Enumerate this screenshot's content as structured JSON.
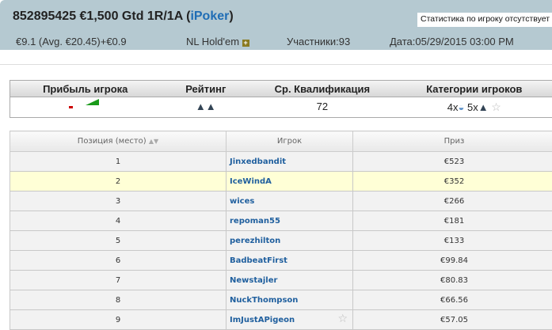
{
  "header": {
    "tournament": "852895425 €1,500 Gtd 1R/1A (",
    "network": "iPoker",
    "close_paren": ")",
    "no_stats": "Статистика по игроку отсутствует",
    "buyin": "€9.1 (Avg. €20.45)+€0.9",
    "game": "NL Hold'em",
    "participants": "Участники:93",
    "date": "Дата:05/29/2015 03:00 PM"
  },
  "stats": {
    "headers": [
      "Прибыль игрока",
      "Рейтинг",
      "Ср. Квалификация",
      "Категории игроков"
    ],
    "avg_qualification": "72",
    "cat_fish": "4x",
    "cat_shark": "5x"
  },
  "results": {
    "headers": [
      "Позиция (место)",
      "Игрок",
      "Приз"
    ],
    "rows": [
      {
        "pos": "1",
        "player": "Jinxedbandit",
        "prize": "€523"
      },
      {
        "pos": "2",
        "player": "IceWindA",
        "prize": "€352"
      },
      {
        "pos": "3",
        "player": "wices",
        "prize": "€266"
      },
      {
        "pos": "4",
        "player": "repoman55",
        "prize": "€181"
      },
      {
        "pos": "5",
        "player": "perezhilton",
        "prize": "€133"
      },
      {
        "pos": "6",
        "player": "BadbeatFirst",
        "prize": "€99.84"
      },
      {
        "pos": "7",
        "player": "Newstajler",
        "prize": "€80.83"
      },
      {
        "pos": "8",
        "player": "NuckThompson",
        "prize": "€66.56"
      },
      {
        "pos": "9",
        "player": "ImJustAPigeon",
        "prize": "€57.05"
      }
    ]
  }
}
